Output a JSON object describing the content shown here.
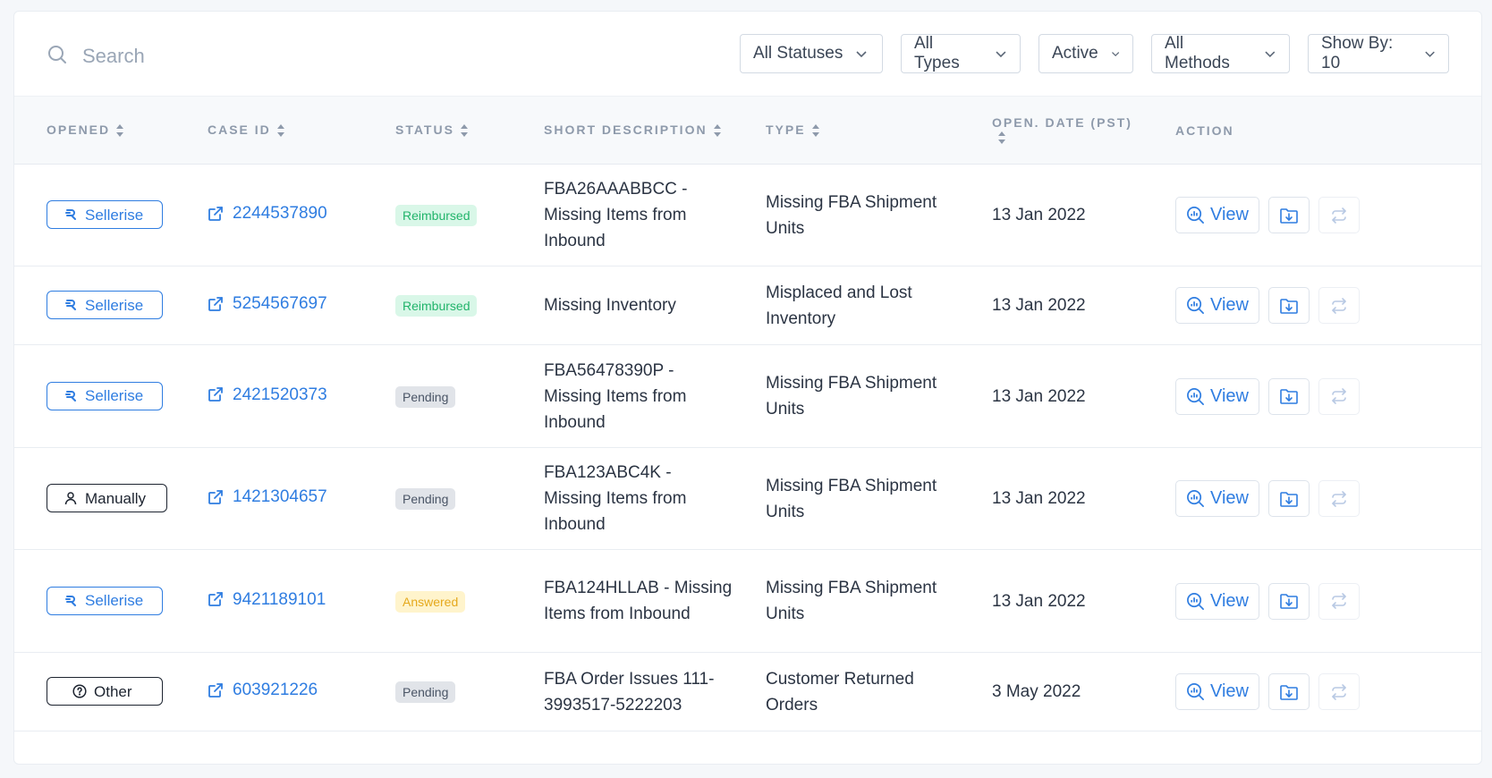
{
  "search": {
    "placeholder": "Search"
  },
  "filters": [
    {
      "label": "All Statuses"
    },
    {
      "label": "All Types"
    },
    {
      "label": "Active"
    },
    {
      "label": "All Methods"
    },
    {
      "label": "Show By: 10"
    }
  ],
  "columns": {
    "opened": "OPENED",
    "case_id": "CASE ID",
    "status": "STATUS",
    "short_description": "SHORT DESCRIPTION",
    "type": "TYPE",
    "open_date": "OPEN. DATE (PST)",
    "action": "ACTION"
  },
  "action_labels": {
    "view": "View"
  },
  "colors": {
    "accent": "#2f7de1",
    "reimbursed": "#22b46b",
    "answered": "#e5a91d",
    "pending": "#4a5566"
  },
  "rows": [
    {
      "opened": "Sellerise",
      "opened_kind": "sellerise",
      "case_id": "2244537890",
      "status": "Reimbursed",
      "status_kind": "reimbursed",
      "description": "FBA26AAABBCC - Missing Items from Inbound",
      "type": "Missing FBA Shipment Units",
      "date": "13 Jan 2022"
    },
    {
      "opened": "Sellerise",
      "opened_kind": "sellerise",
      "case_id": "5254567697",
      "status": "Reimbursed",
      "status_kind": "reimbursed",
      "description": "Missing Inventory",
      "type": "Misplaced and Lost Inventory",
      "date": "13 Jan 2022"
    },
    {
      "opened": "Sellerise",
      "opened_kind": "sellerise",
      "case_id": "2421520373",
      "status": "Pending",
      "status_kind": "pending",
      "description": "FBA56478390P - Missing Items from Inbound",
      "type": "Missing FBA Shipment Units",
      "date": "13 Jan 2022"
    },
    {
      "opened": "Manually",
      "opened_kind": "manual",
      "case_id": "1421304657",
      "status": "Pending",
      "status_kind": "pending",
      "description": "FBA123ABC4K - Missing Items from Inbound",
      "type": "Missing FBA Shipment Units",
      "date": "13 Jan 2022"
    },
    {
      "opened": "Sellerise",
      "opened_kind": "sellerise",
      "case_id": "9421189101",
      "status": "Answered",
      "status_kind": "answered",
      "description": "FBA124HLLAB - Missing Items from Inbound",
      "type": "Missing FBA Shipment Units",
      "date": "13 Jan 2022"
    },
    {
      "opened": "Other",
      "opened_kind": "other",
      "case_id": "603921226",
      "status": "Pending",
      "status_kind": "pending",
      "description": "FBA Order Issues 111-3993517-5222203",
      "type": "Customer Returned Orders",
      "date": "3 May 2022"
    }
  ]
}
